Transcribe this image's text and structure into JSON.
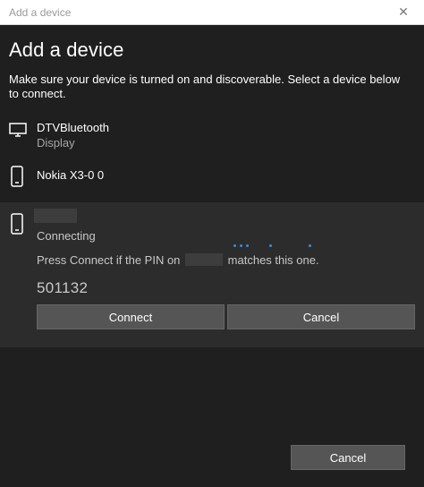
{
  "window": {
    "title": "Add a device",
    "close_glyph": "✕"
  },
  "page": {
    "heading": "Add a device",
    "instructions": "Make sure your device is turned on and discoverable. Select a device below to connect."
  },
  "devices": [
    {
      "name": "DTVBluetooth",
      "subtitle": "Display",
      "icon": "monitor-icon"
    },
    {
      "name": "Nokia X3-0 0",
      "subtitle": "",
      "icon": "phone-icon"
    }
  ],
  "selected_device": {
    "icon": "phone-icon",
    "status": "Connecting",
    "pin_message_before": "Press Connect if the PIN on",
    "pin_message_after": "matches this one.",
    "pin": "501132",
    "connect_label": "Connect",
    "cancel_label": "Cancel"
  },
  "footer": {
    "cancel_label": "Cancel"
  },
  "colors": {
    "background": "#1f1f1f",
    "selected_panel": "#2c2c2c",
    "button": "#555555",
    "progress_dots": "#2f8fe8"
  }
}
